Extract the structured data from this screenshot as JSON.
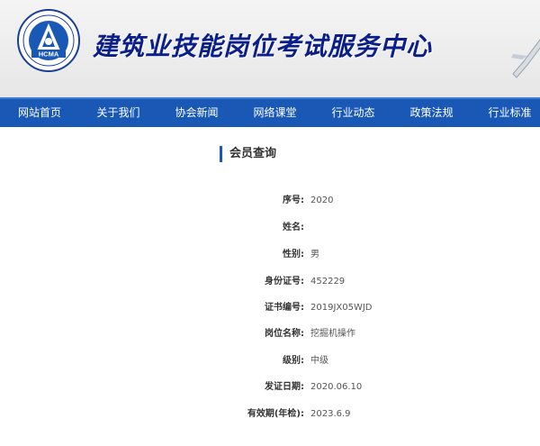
{
  "header": {
    "logo_text": "HCMA",
    "site_title": "建筑业技能岗位考试服务中心"
  },
  "nav": {
    "items": [
      {
        "label": "网站首页"
      },
      {
        "label": "关于我们"
      },
      {
        "label": "协会新闻"
      },
      {
        "label": "网络课堂"
      },
      {
        "label": "行业动态"
      },
      {
        "label": "政策法规"
      },
      {
        "label": "行业标准"
      }
    ]
  },
  "query": {
    "title": "会员查询",
    "fields": [
      {
        "label": "序号:",
        "value": "2020"
      },
      {
        "label": "姓名:",
        "value": ""
      },
      {
        "label": "性别:",
        "value": "男"
      },
      {
        "label": "身份证号:",
        "value": "452229"
      },
      {
        "label": "证书编号:",
        "value": "2019JX05WJD"
      },
      {
        "label": "岗位名称:",
        "value": "挖掘机操作"
      },
      {
        "label": "级别:",
        "value": "中级"
      },
      {
        "label": "发证日期:",
        "value": "2020.06.10"
      },
      {
        "label": "有效期(年检):",
        "value": "2023.6.9"
      }
    ]
  },
  "colors": {
    "nav_bg": "#1a58b6",
    "title": "#0b1f8a"
  }
}
